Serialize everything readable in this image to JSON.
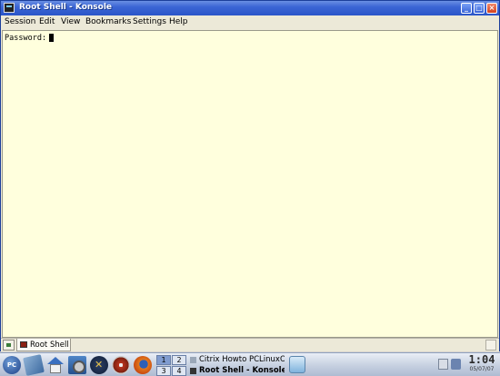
{
  "window": {
    "title": "Root Shell - Konsole",
    "buttons": {
      "minimize": "_",
      "maximize": "□",
      "close": "×"
    }
  },
  "menubar": {
    "items": [
      "Session",
      "Edit",
      "View",
      "Bookmarks",
      "Settings",
      "Help"
    ]
  },
  "terminal": {
    "prompt": "Password:"
  },
  "tabs": [
    {
      "label": "Root Shell"
    }
  ],
  "taskbar": {
    "start_label": "PC",
    "pager": [
      "1",
      "2",
      "3",
      "4"
    ],
    "tasks": [
      {
        "label": "Citrix Howto PCLinuxOS",
        "active": false
      },
      {
        "label": "Root Shell - Konsole",
        "active": true
      }
    ],
    "clock": {
      "time": "1:04",
      "date": "05/07/07"
    }
  },
  "colors": {
    "titlebar": "#2a55c8",
    "terminal_bg": "#ffffdd",
    "taskbar": "#c6d0e0"
  }
}
